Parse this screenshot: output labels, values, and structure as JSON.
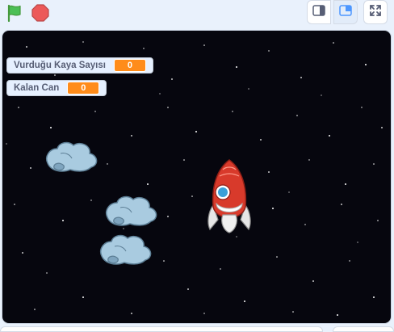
{
  "controls": {
    "green_flag": "green-flag-icon",
    "stop": "stop-sign-icon",
    "small_stage": "small-stage-icon",
    "large_stage": "large-stage-icon",
    "fullscreen": "fullscreen-icon"
  },
  "monitors": [
    {
      "label": "Vurduğu Kaya Sayısı",
      "value": "0"
    },
    {
      "label": "Kalan Can",
      "value": "0"
    }
  ],
  "colors": {
    "stage_bg": "#06060e",
    "monitor_value": "#ff8c1a",
    "flag": "#4cbf56",
    "stop": "#ec5959",
    "rock": "#a9cbe0",
    "rocket_body": "#d83a2b"
  }
}
